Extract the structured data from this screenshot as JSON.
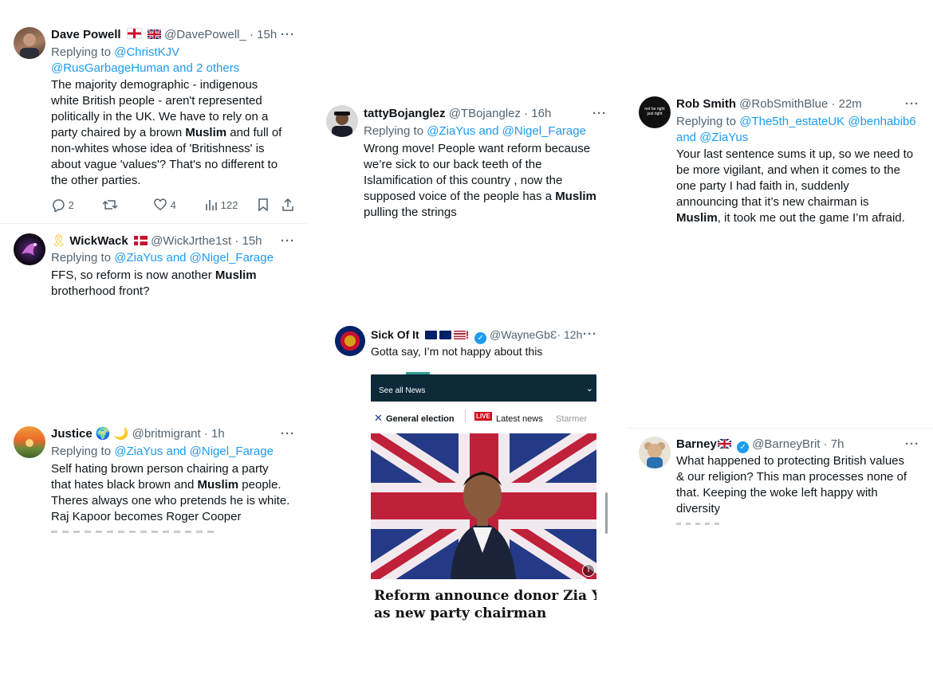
{
  "tweets": {
    "dave": {
      "name": "Dave Powell",
      "handle": "@DavePowell_",
      "time": "· 15h",
      "replying_prefix": "Replying to ",
      "replying_line1": "@ChristKJV",
      "replying_line2": "@RusGarbageHuman and 2 others",
      "lines": [
        "The majority demographic - indigenous",
        "white British people - aren't represented",
        "politically in the UK. We have to rely on a",
        "party chaired by a brown ",
        "Muslim",
        " and full of",
        "non-whites whose idea of 'Britishness' is",
        "about vague 'values'? That's no different to",
        "the other parties."
      ],
      "reply_count": "2",
      "like_count": "4",
      "view_count": "122"
    },
    "wickwack": {
      "name": "WickWack",
      "handle": "@WickJrthe1st",
      "time": "· 15h",
      "replying_prefix": "Replying to ",
      "replying_to": "@ZiaYus and @Nigel_Farage",
      "line1_pre": "FFS, so reform is now another ",
      "line1_bold": "Muslim",
      "line2": "brotherhood front?"
    },
    "justice": {
      "name": "Justice",
      "handle": "@britmigrant",
      "time": "· 1h",
      "replying_prefix": "Replying to ",
      "replying_to": "@ZiaYus and @Nigel_Farage",
      "line1": "Self hating brown person chairing a party",
      "line2_pre": "that hates black brown and ",
      "line2_bold": "Muslim",
      "line2_post": " people.",
      "line3": "Theres always one who pretends he is white.",
      "line4": "Raj Kapoor becomes Roger Cooper"
    },
    "tatty": {
      "name": "tattyBojanglez",
      "handle": "@TBojanglez",
      "time": "· 16h",
      "replying_prefix": "Replying to ",
      "replying_to": "@ZiaYus and @Nigel_Farage",
      "line1": "Wrong move! People want reform because",
      "line2": "we’re sick to our back teeth of the",
      "line3": "Islamification of this country , now the",
      "line4_pre": "supposed voice of the people has a ",
      "line4_bold": "Muslim",
      "line5": "pulling the strings"
    },
    "sick": {
      "name": "Sick Of It",
      "handle": "@WayneGbƐ",
      "time": "· 12h",
      "text": "Gotta say, I’m not happy about this",
      "card": {
        "see_all": "See all News",
        "nav_election": "General election",
        "live_badge": "LIVE",
        "nav_latest": "Latest news",
        "nav_next": "Starmer",
        "headline_1": "Reform announce donor Zia Yusaf",
        "headline_2": "as new party chairman",
        "info_icon": "i"
      }
    },
    "rob": {
      "name": "Rob Smith",
      "handle": "@RobSmithBlue",
      "time": "· 22m",
      "avatar_text": "not far right just right",
      "replying_prefix": "Replying to ",
      "replying_line1": "@The5th_estateUK @benhabib6",
      "replying_line2": "and @ZiaYus",
      "line1": "Your last sentence sums it up, so we need to",
      "line2": "be more vigilant, and when it comes to the",
      "line3": "one party I had faith in, suddenly",
      "line4": "announcing that it’s new chairman is",
      "line5_bold": "Muslim",
      "line5_post": ", it took me out the game I’m afraid."
    },
    "barney": {
      "name": "Barney",
      "handle": "@BarneyBrit",
      "time": "· 7h",
      "line1": "What happened to protecting British values",
      "line2": "& our religion? This man processes none of",
      "line3": "that. Keeping the woke left happy with",
      "line4": "diversity"
    }
  },
  "ui": {
    "more": "···",
    "verified_check": "✓"
  },
  "colors": {
    "link": "#1d9bf0",
    "muted": "#536471",
    "text": "#0f1419",
    "card_header": "#0d2a3a",
    "live_red": "#d0021b"
  }
}
